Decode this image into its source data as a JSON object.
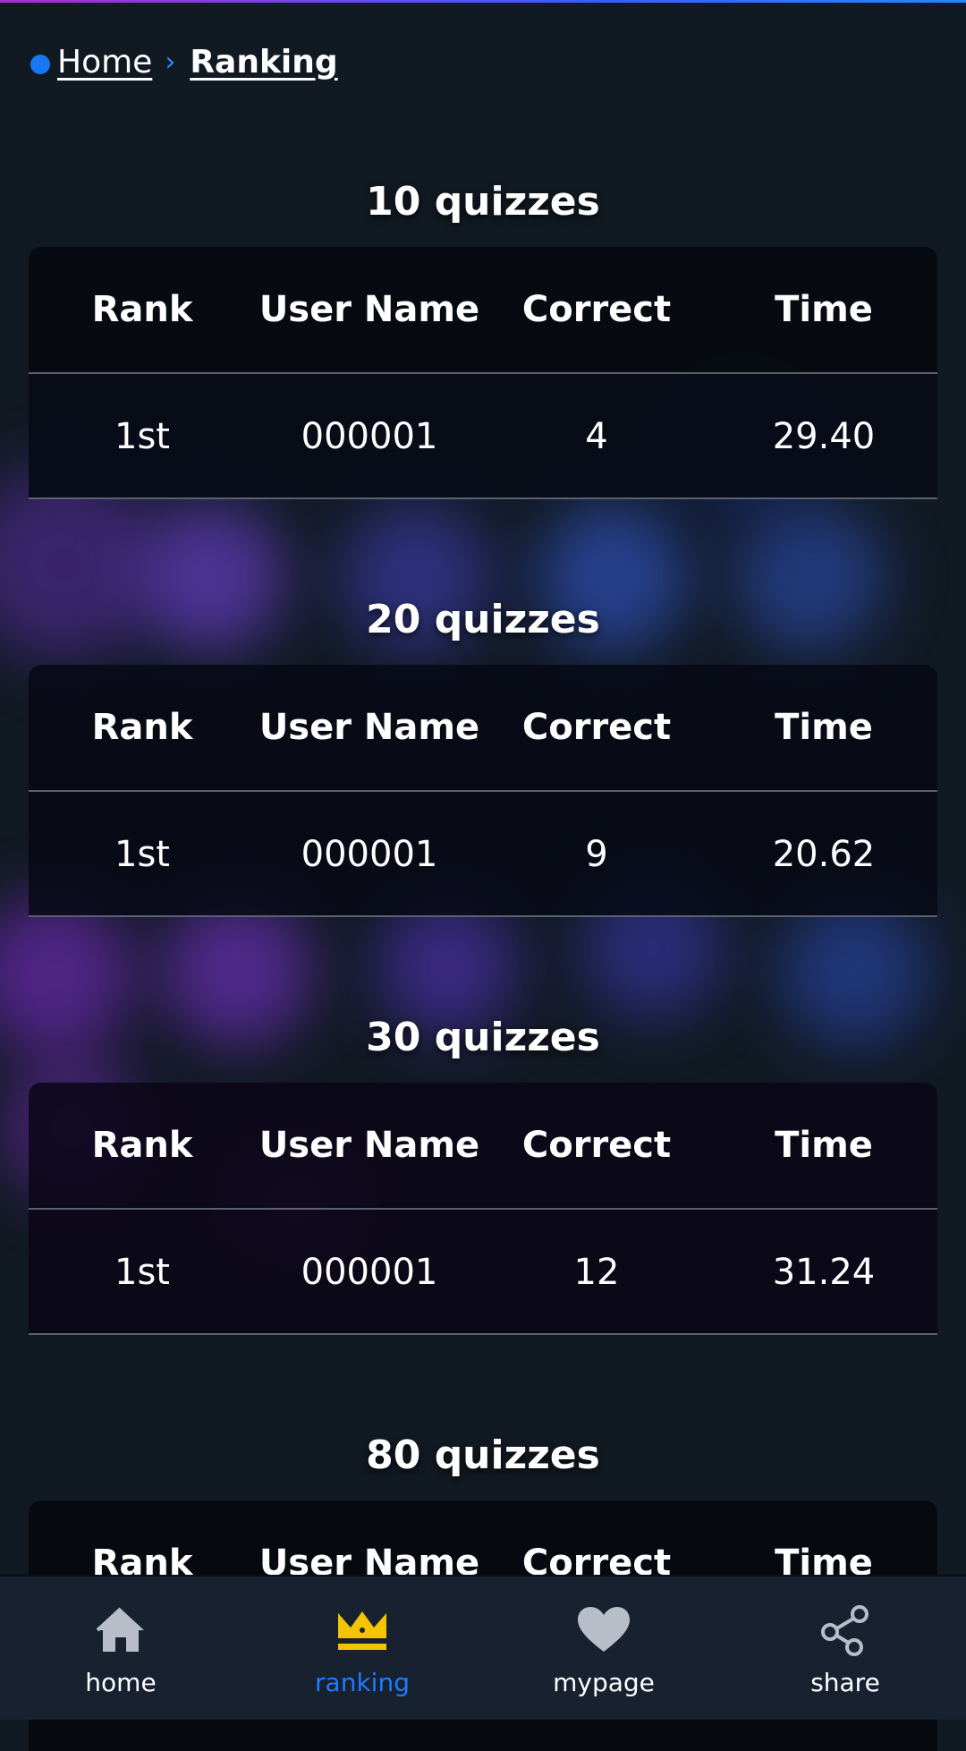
{
  "breadcrumb": {
    "home": "Home",
    "current": "Ranking"
  },
  "table_headers": {
    "rank": "Rank",
    "user": "User Name",
    "correct": "Correct",
    "time": "Time"
  },
  "sections": [
    {
      "title": "10 quizzes",
      "rank": "1st",
      "user": "000001",
      "correct": "4",
      "time": "29.40"
    },
    {
      "title": "20 quizzes",
      "rank": "1st",
      "user": "000001",
      "correct": "9",
      "time": "20.62"
    },
    {
      "title": "30 quizzes",
      "rank": "1st",
      "user": "000001",
      "correct": "12",
      "time": "31.24"
    },
    {
      "title": "80 quizzes"
    }
  ],
  "nav": [
    {
      "label": "home",
      "icon": "home-icon"
    },
    {
      "label": "ranking",
      "icon": "crown-icon",
      "active": true
    },
    {
      "label": "mypage",
      "icon": "heart-icon"
    },
    {
      "label": "share",
      "icon": "share-icon"
    }
  ],
  "colors": {
    "accent": "#1e7bff",
    "crown": "#f5c400",
    "background": "#111922"
  }
}
